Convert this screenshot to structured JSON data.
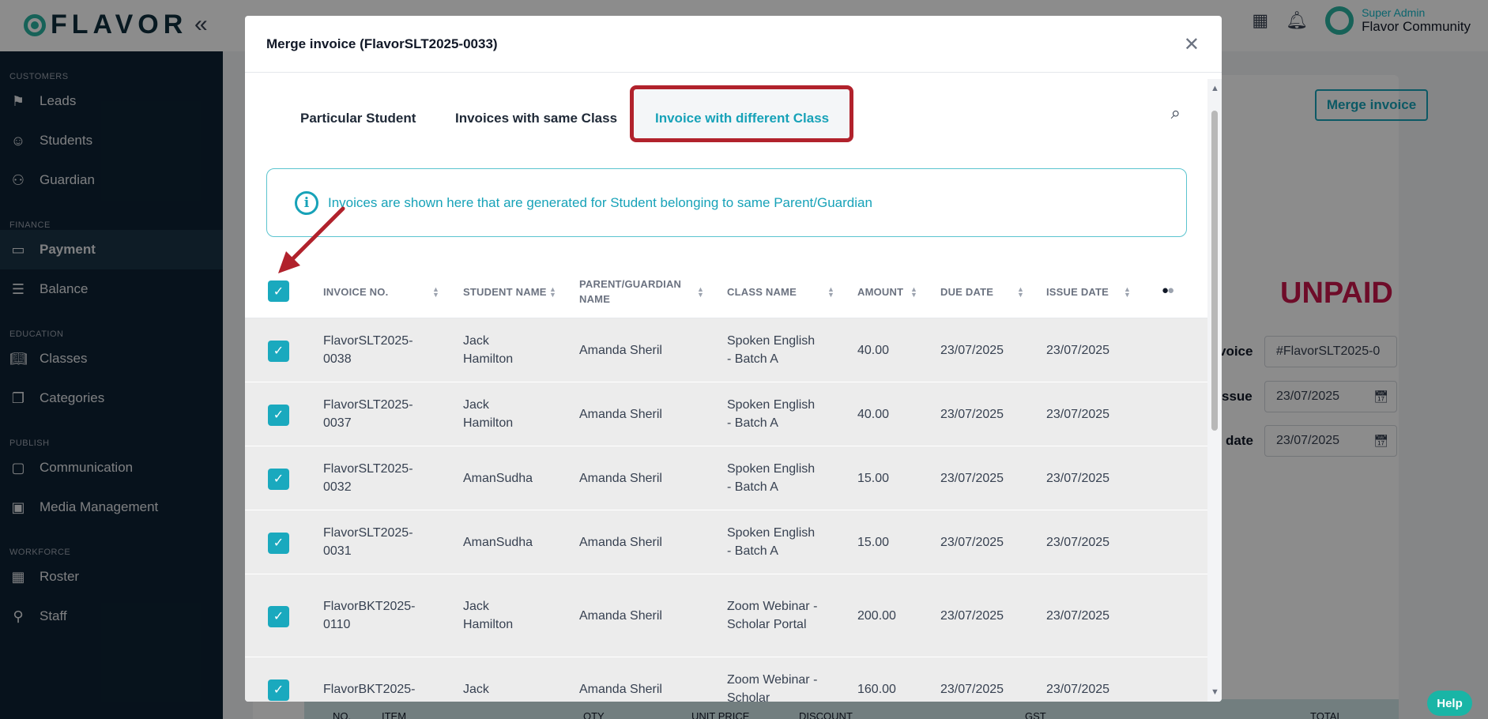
{
  "app": {
    "logo_text": "FLAVOR",
    "user_role": "Super Admin",
    "user_name": "Flavor Community",
    "help_label": "Help"
  },
  "sidebar": {
    "sections": [
      {
        "title": "CUSTOMERS",
        "items": [
          {
            "label": "Leads",
            "icon": "signpost-icon"
          },
          {
            "label": "Students",
            "icon": "student-icon"
          },
          {
            "label": "Guardian",
            "icon": "guardian-icon"
          }
        ]
      },
      {
        "title": "FINANCE",
        "items": [
          {
            "label": "Payment",
            "icon": "card-icon"
          },
          {
            "label": "Balance",
            "icon": "ledger-icon"
          }
        ]
      },
      {
        "title": "EDUCATION",
        "items": [
          {
            "label": "Classes",
            "icon": "book-icon"
          },
          {
            "label": "Categories",
            "icon": "layers-icon"
          }
        ]
      },
      {
        "title": "PUBLISH",
        "items": [
          {
            "label": "Communication",
            "icon": "chat-icon"
          },
          {
            "label": "Media Management",
            "icon": "image-icon"
          }
        ]
      },
      {
        "title": "WORKFORCE",
        "items": [
          {
            "label": "Roster",
            "icon": "calendar-icon"
          },
          {
            "label": "Staff",
            "icon": "person-icon"
          }
        ]
      }
    ],
    "active_item": "Payment"
  },
  "page": {
    "merge_button": "Merge invoice",
    "status": "UNPAID",
    "invoice_label": "voice",
    "invoice_value": "#FlavorSLT2025-0",
    "issue_label": "ssue",
    "issue_value": "23/07/2025",
    "due_label": "date",
    "due_value": "23/07/2025",
    "table_headers": [
      "NO.",
      "ITEM",
      "QTY",
      "UNIT PRICE",
      "DISCOUNT",
      "GST",
      "TOTAL"
    ]
  },
  "modal": {
    "title": "Merge invoice (FlavorSLT2025-0033)",
    "tabs": [
      {
        "label": "Particular Student"
      },
      {
        "label": "Invoices with same Class"
      },
      {
        "label": "Invoice with different Class"
      }
    ],
    "active_tab": 2,
    "info_text": "Invoices are shown here that are generated for Student belonging to same Parent/Guardian",
    "columns": [
      "INVOICE NO.",
      "STUDENT NAME",
      "PARENT/GUARDIAN NAME",
      "CLASS NAME",
      "AMOUNT",
      "DUE DATE",
      "ISSUE DATE"
    ],
    "rows": [
      {
        "invoice": "FlavorSLT2025-0038",
        "student": "Jack Hamilton",
        "guardian": "Amanda Sheril",
        "class": "Spoken English - Batch A",
        "amount": "40.00",
        "due": "23/07/2025",
        "issue": "23/07/2025",
        "checked": true
      },
      {
        "invoice": "FlavorSLT2025-0037",
        "student": "Jack Hamilton",
        "guardian": "Amanda Sheril",
        "class": "Spoken English - Batch A",
        "amount": "40.00",
        "due": "23/07/2025",
        "issue": "23/07/2025",
        "checked": true
      },
      {
        "invoice": "FlavorSLT2025-0032",
        "student": "AmanSudha",
        "guardian": "Amanda Sheril",
        "class": "Spoken English - Batch A",
        "amount": "15.00",
        "due": "23/07/2025",
        "issue": "23/07/2025",
        "checked": true
      },
      {
        "invoice": "FlavorSLT2025-0031",
        "student": "AmanSudha",
        "guardian": "Amanda Sheril",
        "class": "Spoken English - Batch A",
        "amount": "15.00",
        "due": "23/07/2025",
        "issue": "23/07/2025",
        "checked": true
      },
      {
        "invoice": "FlavorBKT2025-0110",
        "student": "Jack Hamilton",
        "guardian": "Amanda Sheril",
        "class": "Zoom Webinar - Scholar Portal",
        "amount": "200.00",
        "due": "23/07/2025",
        "issue": "23/07/2025",
        "checked": true
      },
      {
        "invoice": "FlavorBKT2025-",
        "student": "Jack",
        "guardian": "Amanda Sheril",
        "class": "Zoom Webinar - Scholar",
        "amount": "160.00",
        "due": "23/07/2025",
        "issue": "23/07/2025",
        "checked": true
      }
    ]
  },
  "colors": {
    "accent": "#17a2b8",
    "sidebar_bg": "#0d2233",
    "highlight_frame": "#b1222c",
    "unpaid": "#c8174b"
  }
}
